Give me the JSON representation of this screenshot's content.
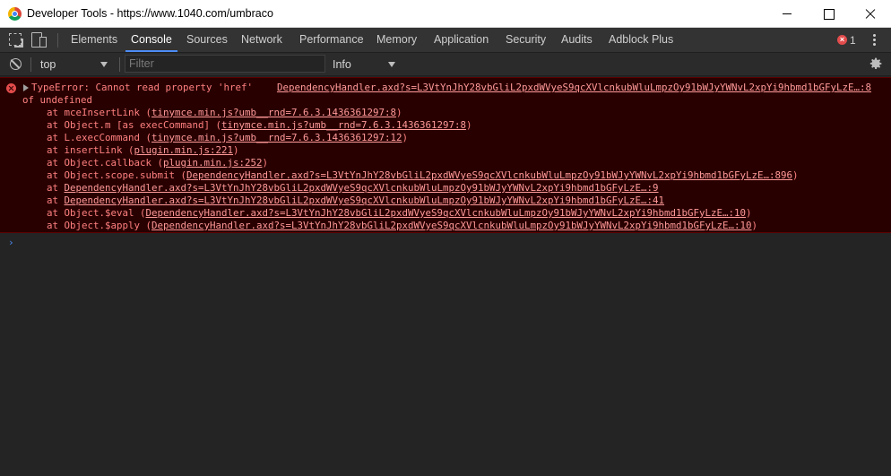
{
  "window": {
    "title": "Developer Tools - https://www.1040.com/umbraco"
  },
  "tabs": [
    {
      "label": "Elements"
    },
    {
      "label": "Console"
    },
    {
      "label": "Sources"
    },
    {
      "label": "Network"
    },
    {
      "label": "Performance"
    },
    {
      "label": "Memory"
    },
    {
      "label": "Application"
    },
    {
      "label": "Security"
    },
    {
      "label": "Audits"
    },
    {
      "label": "Adblock Plus"
    }
  ],
  "active_tab": "Console",
  "error_count": "1",
  "toolbar": {
    "context": "top",
    "filter_placeholder": "Filter",
    "level": "Info"
  },
  "error": {
    "message": "TypeError: Cannot read property 'href'",
    "message_cont": "of undefined",
    "source_link": "DependencyHandler.axd?s=L3VtYnJhY28vbGliL2pxdWVyeS9qcXVlcnkubWluLmpzOy91bWJyYWNvL2xpYi9hbmd1bGFyLzE…:8",
    "stack": [
      {
        "prefix": "at mceInsertLink (",
        "link": "tinymce.min.js?umb__rnd=7.6.3.1436361297:8",
        "suffix": ")"
      },
      {
        "prefix": "at Object.m [as execCommand] (",
        "link": "tinymce.min.js?umb__rnd=7.6.3.1436361297:8",
        "suffix": ")"
      },
      {
        "prefix": "at L.execCommand (",
        "link": "tinymce.min.js?umb__rnd=7.6.3.1436361297:12",
        "suffix": ")"
      },
      {
        "prefix": "at insertLink (",
        "link": "plugin.min.js:221",
        "suffix": ")"
      },
      {
        "prefix": "at Object.callback (",
        "link": "plugin.min.js:252",
        "suffix": ")"
      },
      {
        "prefix": "at Object.scope.submit (",
        "link": "DependencyHandler.axd?s=L3VtYnJhY28vbGliL2pxdWVyeS9qcXVlcnkubWluLmpzOy91bWJyYWNvL2xpYi9hbmd1bGFyLzE…:896",
        "suffix": ")"
      },
      {
        "prefix": "at ",
        "link": "DependencyHandler.axd?s=L3VtYnJhY28vbGliL2pxdWVyeS9qcXVlcnkubWluLmpzOy91bWJyYWNvL2xpYi9hbmd1bGFyLzE…:9",
        "suffix": ""
      },
      {
        "prefix": "at ",
        "link": "DependencyHandler.axd?s=L3VtYnJhY28vbGliL2pxdWVyeS9qcXVlcnkubWluLmpzOy91bWJyYWNvL2xpYi9hbmd1bGFyLzE…:41",
        "suffix": ""
      },
      {
        "prefix": "at Object.$eval (",
        "link": "DependencyHandler.axd?s=L3VtYnJhY28vbGliL2pxdWVyeS9qcXVlcnkubWluLmpzOy91bWJyYWNvL2xpYi9hbmd1bGFyLzE…:10",
        "suffix": ")"
      },
      {
        "prefix": "at Object.$apply (",
        "link": "DependencyHandler.axd?s=L3VtYnJhY28vbGliL2pxdWVyeS9qcXVlcnkubWluLmpzOy91bWJyYWNvL2xpYi9hbmd1bGFyLzE…:10",
        "suffix": ")"
      }
    ]
  },
  "prompt_symbol": "›",
  "colors": {
    "accent": "#4d8cf5",
    "error_bg": "#290000",
    "error_text": "#ff8080"
  },
  "icons": [
    "chrome-logo-icon",
    "inspect-element-icon",
    "device-toolbar-icon",
    "error-icon",
    "kebab-menu-icon",
    "clear-console-icon",
    "gear-icon",
    "expand-triangle-icon"
  ]
}
